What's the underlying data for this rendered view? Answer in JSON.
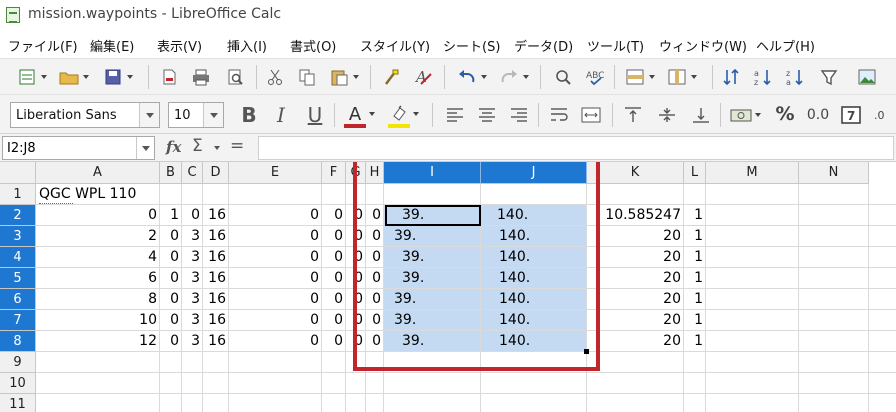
{
  "window": {
    "title": "mission.waypoints - LibreOffice Calc"
  },
  "menu": [
    "ファイル(F)",
    "編集(E)",
    "表示(V)",
    "挿入(I)",
    "書式(O)",
    "スタイル(Y)",
    "シート(S)",
    "データ(D)",
    "ツール(T)",
    "ウィンドウ(W)",
    "ヘルプ(H)"
  ],
  "toolbar1_icons": [
    "new-document-icon",
    "open-folder-icon",
    "save-icon",
    "export-pdf-icon",
    "print-icon",
    "print-preview-icon",
    "cut-icon",
    "copy-icon",
    "paste-icon",
    "clone-formatting-icon",
    "clear-formatting-icon",
    "undo-icon",
    "redo-icon",
    "find-replace-icon",
    "spellcheck-icon",
    "row-icon",
    "column-icon",
    "sort-icon",
    "sort-ascending-icon",
    "sort-descending-icon",
    "autofilter-icon",
    "insert-image-icon"
  ],
  "format": {
    "font_name": "Liberation Sans",
    "font_size": "10",
    "bold": "B",
    "italic": "I",
    "underline": "U",
    "font_color_glyph": "A",
    "percent": "%",
    "decimal": "0.0",
    "accent_color": "#1e78d1",
    "font_color_bar": "#c0262c",
    "highlight_bar": "#f2e600"
  },
  "formula_bar": {
    "name_box": "I2:J8",
    "fx": "fx",
    "sum": "Σ",
    "equals": "=",
    "formula": ""
  },
  "sheet": {
    "columns": [
      "A",
      "B",
      "C",
      "D",
      "E",
      "F",
      "G",
      "H",
      "I",
      "J",
      "K",
      "L",
      "M",
      "N"
    ],
    "selected_columns": [
      "I",
      "J"
    ],
    "row_numbers": [
      "1",
      "2",
      "3",
      "4",
      "5",
      "6",
      "7",
      "8",
      "9",
      "10",
      "11"
    ],
    "selected_rows": [
      "2",
      "3",
      "4",
      "5",
      "6",
      "7",
      "8"
    ],
    "row1_text": "QGC WPL 110",
    "rows": [
      {
        "A": "0",
        "B": "1",
        "C": "0",
        "D": "16",
        "E": "0",
        "F": "0",
        "G": "0",
        "H": "0",
        "I": "39.",
        "J": "140.",
        "K": "10.585247",
        "L": "1"
      },
      {
        "A": "2",
        "B": "0",
        "C": "3",
        "D": "16",
        "E": "0",
        "F": "0",
        "G": "0",
        "H": "0",
        "I": "39.",
        "J": "140.",
        "K": "20",
        "L": "1"
      },
      {
        "A": "4",
        "B": "0",
        "C": "3",
        "D": "16",
        "E": "0",
        "F": "0",
        "G": "0",
        "H": "0",
        "I": "39.",
        "J": "140.",
        "K": "20",
        "L": "1"
      },
      {
        "A": "6",
        "B": "0",
        "C": "3",
        "D": "16",
        "E": "0",
        "F": "0",
        "G": "0",
        "H": "0",
        "I": "39.",
        "J": "140.",
        "K": "20",
        "L": "1"
      },
      {
        "A": "8",
        "B": "0",
        "C": "3",
        "D": "16",
        "E": "0",
        "F": "0",
        "G": "0",
        "H": "0",
        "I": "39.",
        "J": "140.",
        "K": "20",
        "L": "1"
      },
      {
        "A": "10",
        "B": "0",
        "C": "3",
        "D": "16",
        "E": "0",
        "F": "0",
        "G": "0",
        "H": "0",
        "I": "39.",
        "J": "140.",
        "K": "20",
        "L": "1"
      },
      {
        "A": "12",
        "B": "0",
        "C": "3",
        "D": "16",
        "E": "0",
        "F": "0",
        "G": "0",
        "H": "0",
        "I": "39.",
        "J": "140.",
        "K": "20",
        "L": "1"
      }
    ],
    "annotation_color": "#c0262c"
  }
}
